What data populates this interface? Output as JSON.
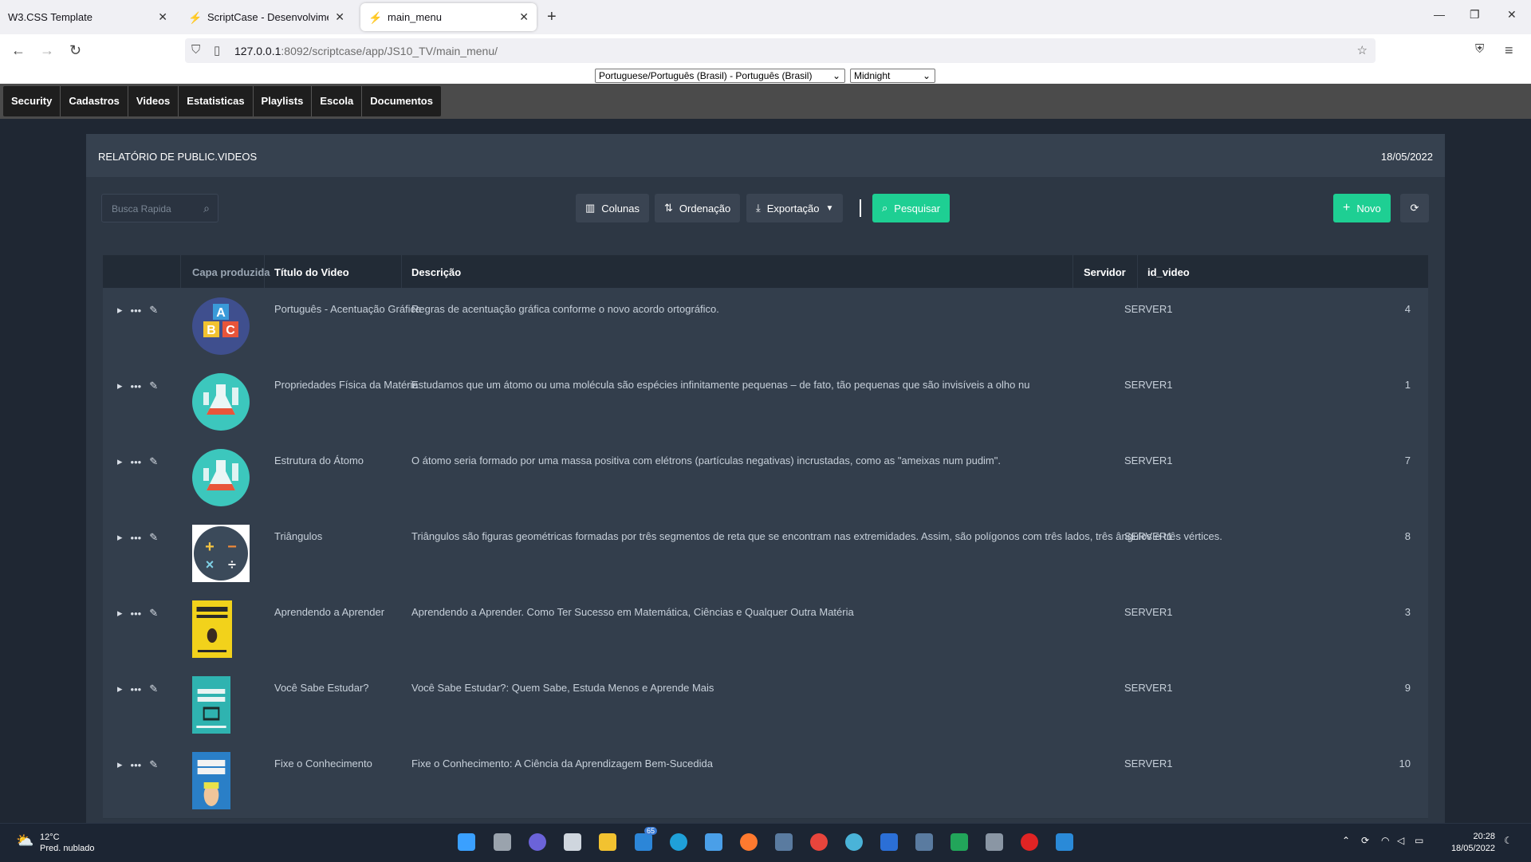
{
  "browser": {
    "tabs": [
      {
        "label": "W3.CSS Template",
        "active": false
      },
      {
        "label": "ScriptCase - Desenvolvimento -",
        "active": false
      },
      {
        "label": "main_menu",
        "active": true
      }
    ],
    "url_host": "127.0.0.1",
    "url_rest": ":8092/scriptcase/app/JS10_TV/main_menu/"
  },
  "language_select": "Portuguese/Português (Brasil) - Português (Brasil)",
  "theme_select": "Midnight",
  "menu": [
    "Security",
    "Cadastros",
    "Videos",
    "Estatisticas",
    "Playlists",
    "Escola",
    "Documentos"
  ],
  "report": {
    "title": "RELATÓRIO DE PUBLIC.VIDEOS",
    "date": "18/05/2022",
    "search_placeholder": "Busca Rapida",
    "toolbar": {
      "columns": "Colunas",
      "ordering": "Ordenação",
      "export": "Exportação",
      "search": "Pesquisar",
      "new": "Novo"
    },
    "columns": {
      "cover": "Capa produzida",
      "title": "Título do Video",
      "description": "Descrição",
      "server": "Servidor",
      "id": "id_video"
    },
    "rows": [
      {
        "title": "Português - Acentuação Gráfica",
        "description": "Regras de acentuação gráfica conforme o novo acordo ortográfico.",
        "server": "SERVER1",
        "id": "4",
        "cover": "abc-blocks"
      },
      {
        "title": "Propriedades Física da Matéria",
        "description": "Estudamos que um átomo ou uma molécula são espécies infinitamente pequenas – de fato, tão pequenas que são invisíveis a olho nu",
        "server": "SERVER1",
        "id": "1",
        "cover": "flask"
      },
      {
        "title": "Estrutura do Átomo",
        "description": "O átomo seria formado por uma massa positiva com elétrons (partículas negativas) incrustadas, como as \"ameixas num pudim\".",
        "server": "SERVER1",
        "id": "7",
        "cover": "flask"
      },
      {
        "title": "Triângulos",
        "description": "Triângulos são figuras geométricas formadas por três segmentos de reta que se encontram nas extremidades. Assim, são polígonos com três lados, três ângulos e três vértices.",
        "server": "SERVER1",
        "id": "8",
        "cover": "math-ops"
      },
      {
        "title": "Aprendendo a Aprender",
        "description": "Aprendendo a Aprender. Como Ter Sucesso em Matemática, Ciências e Qualquer Outra Matéria",
        "server": "SERVER1",
        "id": "3",
        "cover": "book-yellow"
      },
      {
        "title": "Você Sabe Estudar?",
        "description": "Você Sabe Estudar?: Quem Sabe, Estuda Menos e Aprende Mais",
        "server": "SERVER1",
        "id": "9",
        "cover": "book-teal"
      },
      {
        "title": "Fixe o Conhecimento",
        "description": "Fixe o Conhecimento: A Ciência da Aprendizagem Bem-Sucedida",
        "server": "SERVER1",
        "id": "10",
        "cover": "book-blue"
      }
    ]
  },
  "taskbar": {
    "temp": "12°C",
    "weather": "Pred. nublado",
    "mail_badge": "65",
    "time": "20:28",
    "date": "18/05/2022"
  },
  "colors": {
    "accent_green": "#1ecf93",
    "panel_bg": "#2d3744",
    "row_bg": "#333e4c"
  }
}
